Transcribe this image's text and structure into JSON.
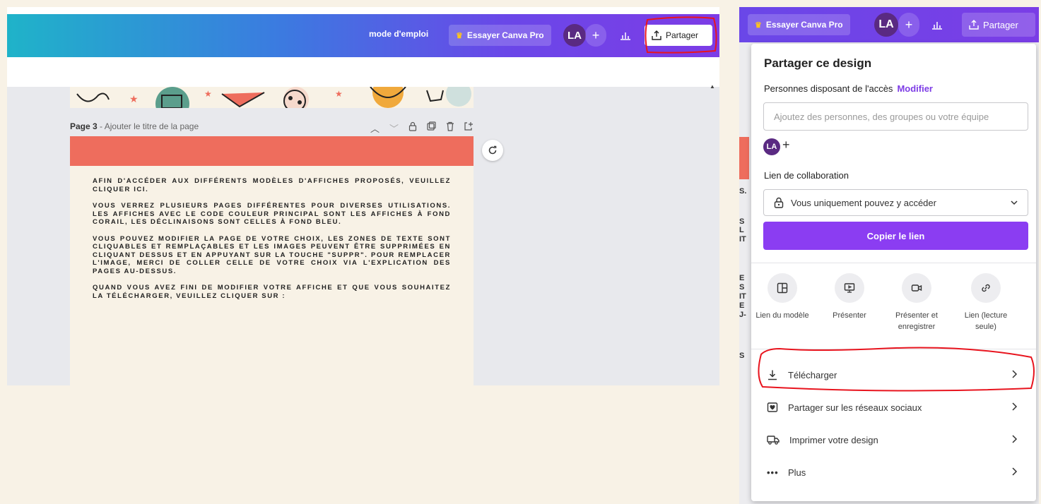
{
  "left": {
    "topbar": {
      "guide_link": "mode d'emploi",
      "pro_button": "Essayer Canva Pro",
      "avatar_initials": "LA",
      "plus": "+",
      "share_button": "Partager"
    },
    "page": {
      "label": "Page 3",
      "separator": " - ",
      "title_placeholder": "Ajouter le titre de la page",
      "paragraphs": [
        "Afin d'accéder aux différents modèles d'affiches proposés, veuillez cliquer ici.",
        "Vous verrez plusieurs pages différentes pour diverses utilisations. Les affiches avec le code couleur principal sont les affiches à fond corail, les déclinaisons sont celles à fond bleu.",
        "Vous pouvez modifier la page de votre choix, les zones de texte sont cliquables et remplaçables et les images peuvent être supprimées en cliquant dessus et en appuyant sur la touche \"suppr\". Pour remplacer l'image, merci de coller celle de votre choix via l'explication des pages au-dessus.",
        "Quand vous avez fini de modifier votre affiche et que vous souhaitez la télécharger, veuillez cliquer sur :"
      ]
    }
  },
  "right": {
    "topbar": {
      "pro_button": "Essayer Canva Pro",
      "avatar_initials": "LA",
      "plus": "+",
      "share_button": "Partager"
    },
    "background_fragments": [
      "S.",
      "S",
      "L",
      "IT",
      "E",
      "S",
      "IT",
      "E",
      "J-",
      "S"
    ],
    "panel": {
      "title": "Partager ce design",
      "access_label": "Personnes disposant de l'accès",
      "modify_link": "Modifier",
      "people_placeholder": "Ajoutez des personnes, des groupes ou votre équipe",
      "avatar_initials": "LA",
      "plus": "+",
      "collab_label": "Lien de collaboration",
      "access_select_value": "Vous uniquement pouvez y accéder",
      "copy_button": "Copier le lien",
      "options": [
        {
          "line1": "Lien du modèle",
          "line2": ""
        },
        {
          "line1": "Présenter",
          "line2": ""
        },
        {
          "line1": "Présenter et",
          "line2": "enregistrer"
        },
        {
          "line1": "Lien (lecture",
          "line2": "seule)"
        }
      ],
      "rows": {
        "download": "Télécharger",
        "social": "Partager sur les réseaux sociaux",
        "print": "Imprimer votre design",
        "more": "Plus"
      }
    }
  },
  "colors": {
    "accent_purple": "#8b3df2",
    "coral": "#ee6d5d",
    "annotation_red": "#e8141e",
    "cream": "#f8f2e6"
  }
}
